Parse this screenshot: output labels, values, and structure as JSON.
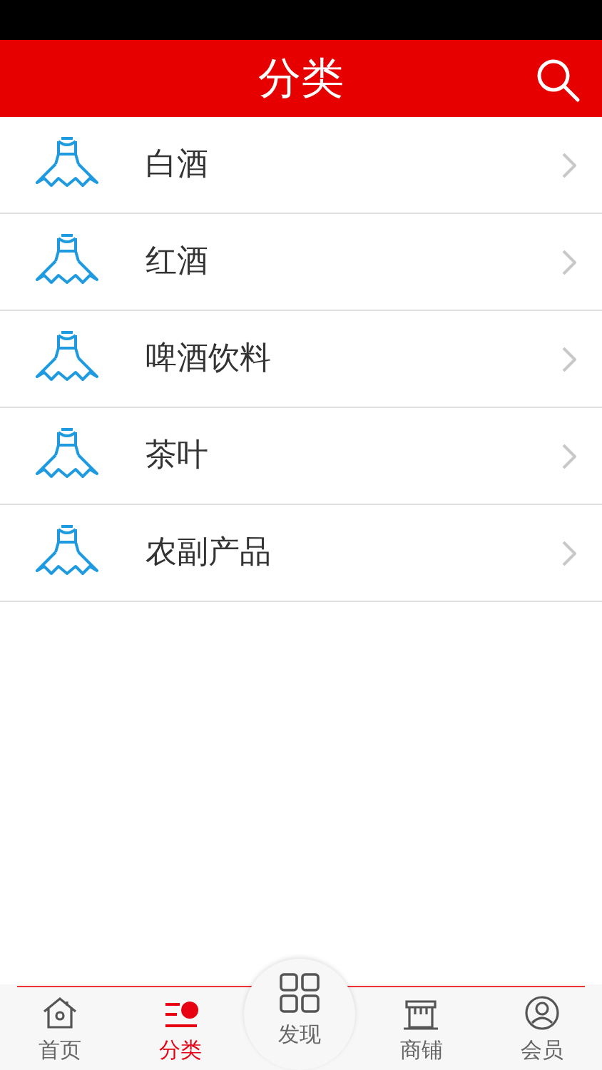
{
  "header": {
    "title": "分类"
  },
  "categories": [
    {
      "label": "白酒"
    },
    {
      "label": "红酒"
    },
    {
      "label": "啤酒饮料"
    },
    {
      "label": "茶叶"
    },
    {
      "label": "农副产品"
    }
  ],
  "tabs": [
    {
      "kind": "home",
      "label": "首页",
      "selected": false
    },
    {
      "kind": "category",
      "label": "分类",
      "selected": true
    },
    {
      "kind": "discover",
      "label": "发现",
      "selected": false
    },
    {
      "kind": "shop",
      "label": "商铺",
      "selected": false
    },
    {
      "kind": "member",
      "label": "会员",
      "selected": false
    }
  ]
}
